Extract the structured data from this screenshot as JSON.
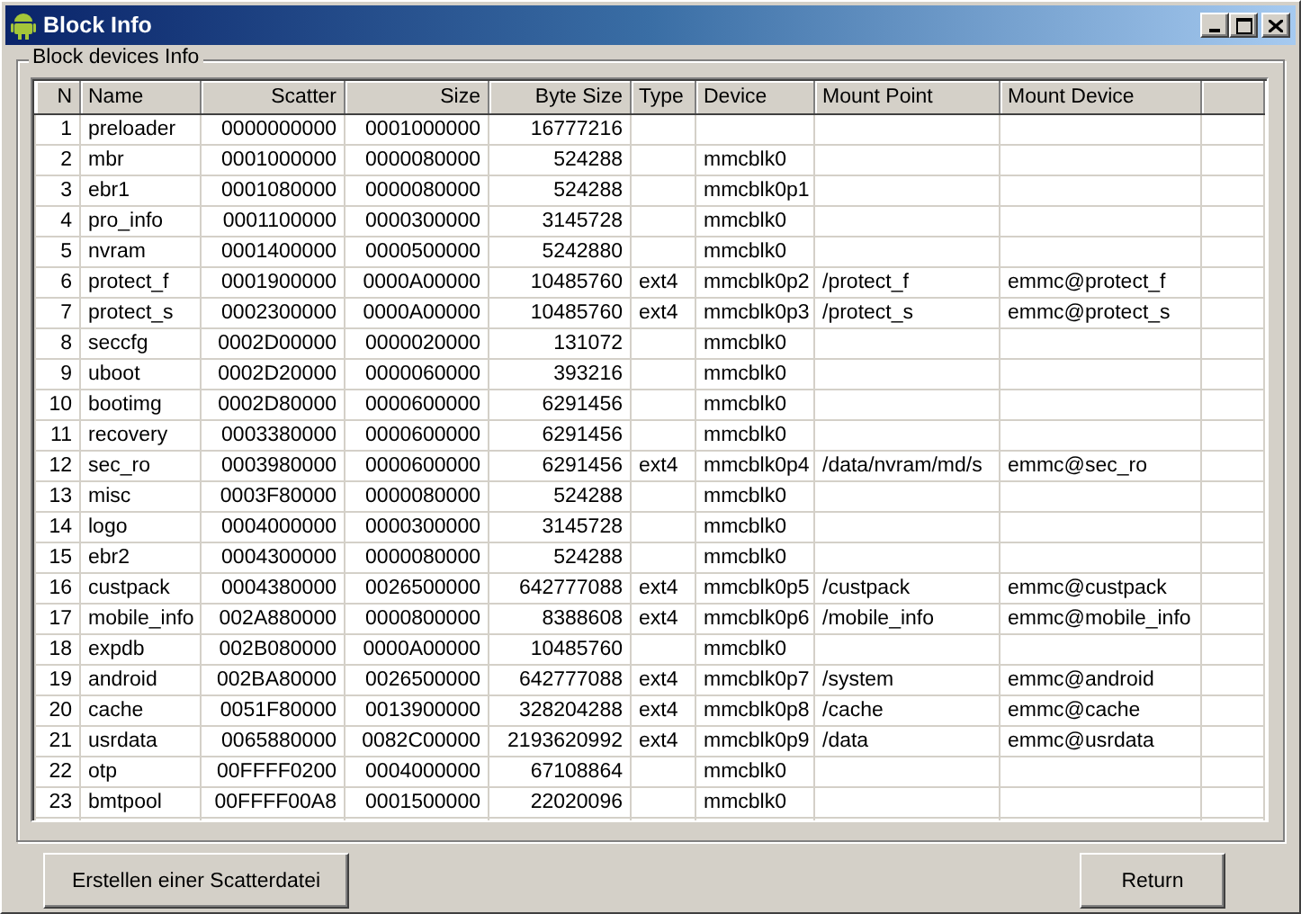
{
  "window": {
    "title": "Block Info"
  },
  "group": {
    "title": "Block devices Info"
  },
  "table": {
    "columns": [
      {
        "label": "N"
      },
      {
        "label": "Name"
      },
      {
        "label": "Scatter"
      },
      {
        "label": "Size"
      },
      {
        "label": "Byte Size"
      },
      {
        "label": "Type"
      },
      {
        "label": "Device"
      },
      {
        "label": "Mount Point"
      },
      {
        "label": "Mount Device"
      }
    ],
    "rows": [
      {
        "n": "1",
        "name": "preloader",
        "scatter": "0000000000",
        "size": "0001000000",
        "byte_size": "16777216"
      },
      {
        "n": "2",
        "name": "mbr",
        "scatter": "0001000000",
        "size": "0000080000",
        "byte_size": "524288",
        "device": "mmcblk0"
      },
      {
        "n": "3",
        "name": "ebr1",
        "scatter": "0001080000",
        "size": "0000080000",
        "byte_size": "524288",
        "device": "mmcblk0p1"
      },
      {
        "n": "4",
        "name": "pro_info",
        "scatter": "0001100000",
        "size": "0000300000",
        "byte_size": "3145728",
        "device": "mmcblk0"
      },
      {
        "n": "5",
        "name": "nvram",
        "scatter": "0001400000",
        "size": "0000500000",
        "byte_size": "5242880",
        "device": "mmcblk0"
      },
      {
        "n": "6",
        "name": "protect_f",
        "scatter": "0001900000",
        "size": "0000A00000",
        "byte_size": "10485760",
        "type": "ext4",
        "device": "mmcblk0p2",
        "mount_point": "/protect_f",
        "mount_device": "emmc@protect_f"
      },
      {
        "n": "7",
        "name": "protect_s",
        "scatter": "0002300000",
        "size": "0000A00000",
        "byte_size": "10485760",
        "type": "ext4",
        "device": "mmcblk0p3",
        "mount_point": "/protect_s",
        "mount_device": "emmc@protect_s"
      },
      {
        "n": "8",
        "name": "seccfg",
        "scatter": "0002D00000",
        "size": "0000020000",
        "byte_size": "131072",
        "device": "mmcblk0"
      },
      {
        "n": "9",
        "name": "uboot",
        "scatter": "0002D20000",
        "size": "0000060000",
        "byte_size": "393216",
        "device": "mmcblk0"
      },
      {
        "n": "10",
        "name": "bootimg",
        "scatter": "0002D80000",
        "size": "0000600000",
        "byte_size": "6291456",
        "device": "mmcblk0"
      },
      {
        "n": "11",
        "name": "recovery",
        "scatter": "0003380000",
        "size": "0000600000",
        "byte_size": "6291456",
        "device": "mmcblk0"
      },
      {
        "n": "12",
        "name": "sec_ro",
        "scatter": "0003980000",
        "size": "0000600000",
        "byte_size": "6291456",
        "type": "ext4",
        "device": "mmcblk0p4",
        "mount_point": "/data/nvram/md/s",
        "mount_device": "emmc@sec_ro"
      },
      {
        "n": "13",
        "name": "misc",
        "scatter": "0003F80000",
        "size": "0000080000",
        "byte_size": "524288",
        "device": "mmcblk0"
      },
      {
        "n": "14",
        "name": "logo",
        "scatter": "0004000000",
        "size": "0000300000",
        "byte_size": "3145728",
        "device": "mmcblk0"
      },
      {
        "n": "15",
        "name": "ebr2",
        "scatter": "0004300000",
        "size": "0000080000",
        "byte_size": "524288",
        "device": "mmcblk0"
      },
      {
        "n": "16",
        "name": "custpack",
        "scatter": "0004380000",
        "size": "0026500000",
        "byte_size": "642777088",
        "type": "ext4",
        "device": "mmcblk0p5",
        "mount_point": "/custpack",
        "mount_device": "emmc@custpack"
      },
      {
        "n": "17",
        "name": "mobile_info",
        "scatter": "002A880000",
        "size": "0000800000",
        "byte_size": "8388608",
        "type": "ext4",
        "device": "mmcblk0p6",
        "mount_point": "/mobile_info",
        "mount_device": "emmc@mobile_info"
      },
      {
        "n": "18",
        "name": "expdb",
        "scatter": "002B080000",
        "size": "0000A00000",
        "byte_size": "10485760",
        "device": "mmcblk0"
      },
      {
        "n": "19",
        "name": "android",
        "scatter": "002BA80000",
        "size": "0026500000",
        "byte_size": "642777088",
        "type": "ext4",
        "device": "mmcblk0p7",
        "mount_point": "/system",
        "mount_device": "emmc@android"
      },
      {
        "n": "20",
        "name": "cache",
        "scatter": "0051F80000",
        "size": "0013900000",
        "byte_size": "328204288",
        "type": "ext4",
        "device": "mmcblk0p8",
        "mount_point": "/cache",
        "mount_device": "emmc@cache"
      },
      {
        "n": "21",
        "name": "usrdata",
        "scatter": "0065880000",
        "size": "0082C00000",
        "byte_size": "2193620992",
        "type": "ext4",
        "device": "mmcblk0p9",
        "mount_point": "/data",
        "mount_device": "emmc@usrdata"
      },
      {
        "n": "22",
        "name": "otp",
        "scatter": "00FFFF0200",
        "size": "0004000000",
        "byte_size": "67108864",
        "device": "mmcblk0"
      },
      {
        "n": "23",
        "name": "bmtpool",
        "scatter": "00FFFF00A8",
        "size": "0001500000",
        "byte_size": "22020096",
        "device": "mmcblk0"
      }
    ]
  },
  "buttons": [
    {
      "label": "Erstellen einer Scatterdatei"
    },
    {
      "label": "Return"
    }
  ]
}
